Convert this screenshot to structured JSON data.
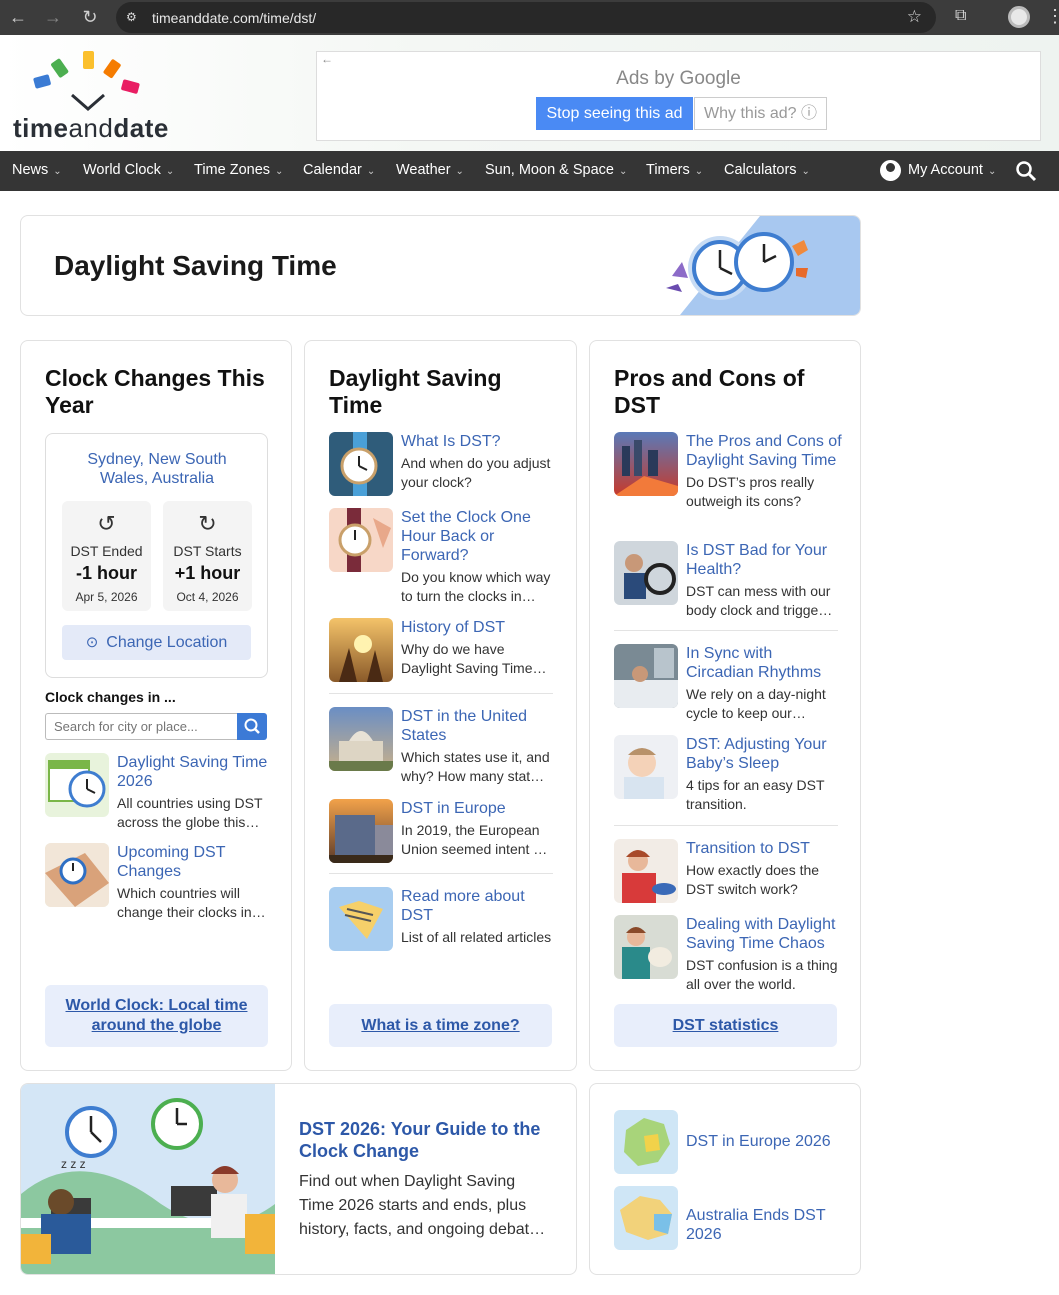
{
  "browser": {
    "url": "timeanddate.com/time/dst/"
  },
  "logo": {
    "time": "time",
    "and": "and",
    "date": "date"
  },
  "ad": {
    "title": "Ads by Google",
    "stop": "Stop seeing this ad",
    "why": "Why this ad? ⓘ"
  },
  "nav": {
    "items": [
      "News",
      "World Clock",
      "Time Zones",
      "Calendar",
      "Weather",
      "Sun, Moon & Space",
      "Timers",
      "Calculators"
    ],
    "account": "My Account"
  },
  "hero": {
    "title": "Daylight Saving Time"
  },
  "col1": {
    "title": "Clock Changes This Year",
    "location": "Sydney, New South Wales, Australia",
    "ended": {
      "label": "DST Ended",
      "value": "-1 hour",
      "date": "Apr 5, 2026"
    },
    "starts": {
      "label": "DST Starts",
      "value": "+1 hour",
      "date": "Oct 4, 2026"
    },
    "change_location": "Change Location",
    "search_heading": "Clock changes in ...",
    "search_placeholder": "Search for city or place...",
    "articles": [
      {
        "title": "Daylight Saving Time 2026",
        "desc": "All countries using DST across the globe this…"
      },
      {
        "title": "Upcoming DST Changes",
        "desc": "Which countries will change their clocks in…"
      }
    ],
    "cta": "World Clock: Local time around the globe"
  },
  "col2": {
    "title": "Daylight Saving Time",
    "articles": [
      {
        "title": "What Is DST?",
        "desc": "And when do you adjust your clock?"
      },
      {
        "title": "Set the Clock One Hour Back or Forward?",
        "desc": "Do you know which way to turn the clocks in…"
      },
      {
        "title": "History of DST",
        "desc": "Why do we have Daylight Saving Time…"
      },
      {
        "title": "DST in the United States",
        "desc": "Which states use it, and why? How many stat…"
      },
      {
        "title": "DST in Europe",
        "desc": "In 2019, the European Union seemed intent …"
      },
      {
        "title": "Read more about DST",
        "desc": "List of all related articles"
      }
    ],
    "cta": "What is a time zone?"
  },
  "col3": {
    "title": "Pros and Cons of DST",
    "articles": [
      {
        "title": "The Pros and Cons of Daylight Saving Time",
        "desc": "Do DST’s pros really outweigh its cons?"
      },
      {
        "title": "Is DST Bad for Your Health?",
        "desc": "DST can mess with our body clock and trigge…"
      },
      {
        "title": "In Sync with Circadian Rhythms",
        "desc": "We rely on a day-night cycle to keep our…"
      },
      {
        "title": "DST: Adjusting Your Baby’s Sleep",
        "desc": "4 tips for an easy DST transition."
      },
      {
        "title": "Transition to DST",
        "desc": "How exactly does the DST switch work?"
      },
      {
        "title": "Dealing with Daylight Saving Time Chaos",
        "desc": "DST confusion is a thing all over the world."
      }
    ],
    "cta": "DST statistics"
  },
  "feature": {
    "title": "DST 2026: Your Guide to the Clock Change",
    "desc": "Find out when Daylight Saving Time 2026 starts and ends, plus history, facts, and ongoing debat…"
  },
  "side": {
    "items": [
      "DST in Europe 2026",
      "Australia Ends DST 2026"
    ]
  },
  "colors": {
    "link": "#3c66b4",
    "nav_bg": "#353535",
    "cta_bg": "#e8eefb"
  }
}
